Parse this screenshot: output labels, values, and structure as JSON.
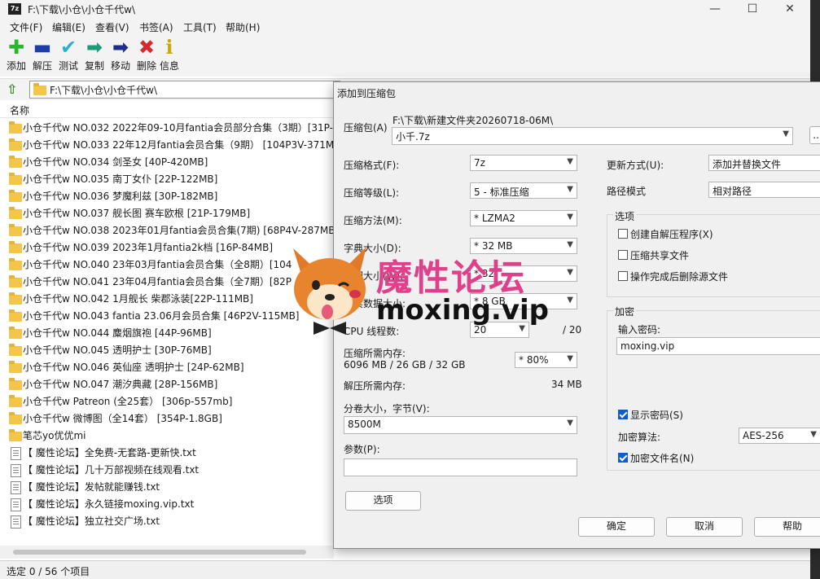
{
  "window": {
    "app_icon": "7z",
    "title": "F:\\下载\\小仓\\小仓千代w\\",
    "minimize": "—",
    "maximize": "☐",
    "close": "✕"
  },
  "menu": [
    "文件(F)",
    "编辑(E)",
    "查看(V)",
    "书签(A)",
    "工具(T)",
    "帮助(H)"
  ],
  "toolbar": [
    {
      "label": "添加",
      "icon": "plus-icon",
      "glyph": "✚",
      "color": "#2db52d"
    },
    {
      "label": "解压",
      "icon": "minus-icon",
      "glyph": "▬",
      "color": "#1c3ea8"
    },
    {
      "label": "测试",
      "icon": "check-icon",
      "glyph": "✔",
      "color": "#26b3c7"
    },
    {
      "label": "复制",
      "icon": "copy-arrow-icon",
      "glyph": "➡",
      "color": "#1e9a7a"
    },
    {
      "label": "移动",
      "icon": "move-arrow-icon",
      "glyph": "➡",
      "color": "#1c2f8f"
    },
    {
      "label": "删除",
      "icon": "delete-icon",
      "glyph": "✖",
      "color": "#d42a2a"
    },
    {
      "label": "信息",
      "icon": "info-icon",
      "glyph": "ℹ",
      "color": "#c9a80c"
    }
  ],
  "address": "F:\\下载\\小仓\\小仓千代w\\",
  "list_header": "名称",
  "files": [
    {
      "type": "folder",
      "name": "小仓千代w NO.032 2022年09-10月fantia会员部分合集（3期）[31P-72"
    },
    {
      "type": "folder",
      "name": "小仓千代w NO.033 22年12月fantia会员合集（9期） [104P3V-371MB"
    },
    {
      "type": "folder",
      "name": "小仓千代w NO.034 剑圣女 [40P-420MB]"
    },
    {
      "type": "folder",
      "name": "小仓千代w NO.035 南丁女仆 [22P-122MB]"
    },
    {
      "type": "folder",
      "name": "小仓千代w NO.036 梦魔利兹 [30P-182MB]"
    },
    {
      "type": "folder",
      "name": "小仓千代w NO.037 舰长图 赛车欧根 [21P-179MB]"
    },
    {
      "type": "folder",
      "name": "小仓千代w NO.038 2023年01月fantia会员合集(7期) [68P4V-287MB]"
    },
    {
      "type": "folder",
      "name": "小仓千代w NO.039 2023年1月fantia2k档 [16P-84MB]"
    },
    {
      "type": "folder",
      "name": "小仓千代w NO.040 23年03月fantia会员合集（全8期）[104"
    },
    {
      "type": "folder",
      "name": "小仓千代w NO.041 23年04月fantia会员合集（全7期）[82P"
    },
    {
      "type": "folder",
      "name": "小仓千代w NO.042 1月舰长 柴郡泳装[22P-111MB]"
    },
    {
      "type": "folder",
      "name": "小仓千代w NO.043 fantia 23.06月会员合集 [46P2V-115MB]"
    },
    {
      "type": "folder",
      "name": "小仓千代w NO.044 麋烟旗袍 [44P-96MB]"
    },
    {
      "type": "folder",
      "name": "小仓千代w NO.045 透明护士 [30P-76MB]"
    },
    {
      "type": "folder",
      "name": "小仓千代w NO.046 英仙座 透明护士 [24P-62MB]"
    },
    {
      "type": "folder",
      "name": "小仓千代w NO.047 潮汐典藏 [28P-156MB]"
    },
    {
      "type": "folder",
      "name": "小仓千代w Patreon (全25套） [306p-557mb]"
    },
    {
      "type": "folder",
      "name": "小仓千代w 微博图（全14套） [354P-1.8GB]"
    },
    {
      "type": "folder",
      "name": "笔芯yo优优mi"
    },
    {
      "type": "text",
      "name": "【 魔性论坛】全免费-无套路-更新快.txt"
    },
    {
      "type": "text",
      "name": "【 魔性论坛】几十万部视频在线观看.txt"
    },
    {
      "type": "text",
      "name": "【 魔性论坛】发帖就能赚钱.txt"
    },
    {
      "type": "text",
      "name": "【 魔性论坛】永久链接moxing.vip.txt"
    },
    {
      "type": "text",
      "name": "【 魔性论坛】独立社交广场.txt"
    }
  ],
  "status": "选定 0 / 56 个项目",
  "dialog": {
    "title": "添加到压缩包",
    "archive_label": "压缩包(A)",
    "archive_path": "F:\\下载\\新建文件夹20260718-06M\\",
    "archive_name": "小千.7z",
    "browse": "...",
    "format_label": "压缩格式(F):",
    "format_value": "7z",
    "level_label": "压缩等级(L):",
    "level_value": "5 - 标准压缩",
    "method_label": "压缩方法(M):",
    "method_value": "* LZMA2",
    "dict_label": "字典大小(D):",
    "dict_value": "* 32 MB",
    "word_label": "单词大小(W):",
    "word_value": "* 32",
    "solid_label": "固实数据大小:",
    "solid_value": "* 8 GB",
    "threads_label": "CPU 线程数:",
    "threads_value": "20",
    "threads_total": "/ 20",
    "mem_label": "压缩所需内存:",
    "mem_value": "6096 MB / 26 GB / 32 GB",
    "mem_percent": "* 80%",
    "decomp_label": "解压所需内存:",
    "decomp_value": "34 MB",
    "split_label": "分卷大小，字节(V):",
    "split_value": "8500M",
    "params_label": "参数(P):",
    "params_value": "",
    "options_button": "选项",
    "update_label": "更新方式(U):",
    "update_value": "添加并替换文件",
    "path_label": "路径模式",
    "path_value": "相对路径",
    "options_group": "选项",
    "opt_sfx": "创建自解压程序(X)",
    "opt_shared": "压缩共享文件",
    "opt_delete": "操作完成后删除源文件",
    "encrypt_group": "加密",
    "password_label": "输入密码:",
    "password_value": "moxing.vip",
    "show_password": "显示密码(S)",
    "enc_method_label": "加密算法:",
    "enc_method_value": "AES-256",
    "encrypt_names": "加密文件名(N)",
    "ok": "确定",
    "cancel": "取消",
    "help": "帮助"
  },
  "watermark": {
    "cn": "魔性论坛",
    "en": "moxing.vip"
  }
}
